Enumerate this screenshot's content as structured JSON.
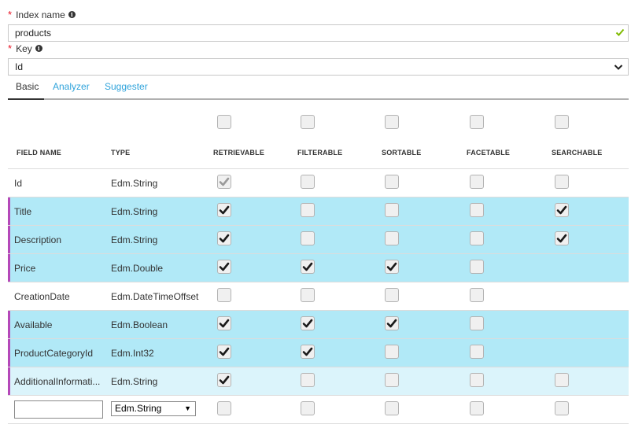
{
  "index_name": {
    "label": "Index name",
    "value": "products",
    "info_glyph": "i",
    "required_mark": "*"
  },
  "key": {
    "label": "Key",
    "value": "Id",
    "info_glyph": "i",
    "required_mark": "*"
  },
  "tabs": [
    {
      "label": "Basic",
      "active": true
    },
    {
      "label": "Analyzer",
      "active": false
    },
    {
      "label": "Suggester",
      "active": false
    }
  ],
  "columns": {
    "field_name": "FIELD NAME",
    "type": "TYPE",
    "retrievable": "RETRIEVABLE",
    "filterable": "FILTERABLE",
    "sortable": "SORTABLE",
    "facetable": "FACETABLE",
    "searchable": "SEARCHABLE"
  },
  "fields": [
    {
      "name": "Id",
      "type": "Edm.String",
      "retrievable": true,
      "filterable": false,
      "sortable": false,
      "facetable": false,
      "searchable": false,
      "highlight": "none",
      "retrievable_disabled": true
    },
    {
      "name": "Title",
      "type": "Edm.String",
      "retrievable": true,
      "filterable": false,
      "sortable": false,
      "facetable": false,
      "searchable": true,
      "highlight": "strong"
    },
    {
      "name": "Description",
      "type": "Edm.String",
      "retrievable": true,
      "filterable": false,
      "sortable": false,
      "facetable": false,
      "searchable": true,
      "highlight": "strong"
    },
    {
      "name": "Price",
      "type": "Edm.Double",
      "retrievable": true,
      "filterable": true,
      "sortable": true,
      "facetable": false,
      "searchable": null,
      "highlight": "strong"
    },
    {
      "name": "CreationDate",
      "type": "Edm.DateTimeOffset",
      "retrievable": false,
      "filterable": false,
      "sortable": false,
      "facetable": false,
      "searchable": null,
      "highlight": "none"
    },
    {
      "name": "Available",
      "type": "Edm.Boolean",
      "retrievable": true,
      "filterable": true,
      "sortable": true,
      "facetable": false,
      "searchable": null,
      "highlight": "strong"
    },
    {
      "name": "ProductCategoryId",
      "type": "Edm.Int32",
      "retrievable": true,
      "filterable": true,
      "sortable": false,
      "facetable": false,
      "searchable": null,
      "highlight": "strong"
    },
    {
      "name": "AdditionalInformati...",
      "type": "Edm.String",
      "retrievable": true,
      "filterable": false,
      "sortable": false,
      "facetable": false,
      "searchable": false,
      "highlight": "light"
    }
  ],
  "new_field": {
    "name_value": "",
    "type_value": "Edm.String",
    "dropdown_glyph": "▼"
  },
  "colors": {
    "accent_link": "#2fa3db",
    "row_highlight": "#b1e9f7",
    "row_highlight_light": "#dbf4fb",
    "modified_marker": "#b548b9",
    "valid": "#7fba00",
    "required": "#e81123"
  }
}
